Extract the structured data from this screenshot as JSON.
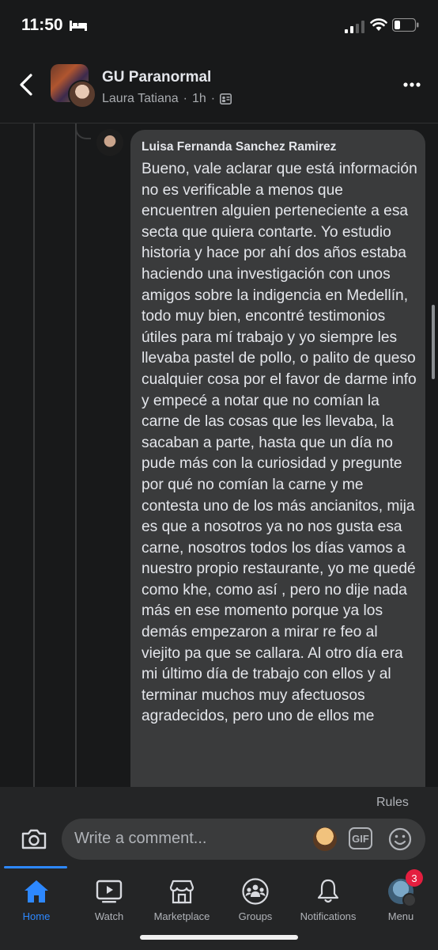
{
  "status_bar": {
    "time": "11:50"
  },
  "header": {
    "group_name": "GU Paranormal",
    "poster_name": "Laura Tatiana",
    "time_ago": "1h",
    "separator": "·"
  },
  "comment": {
    "author": "Luisa Fernanda Sanchez Ramirez",
    "text": "Bueno, vale aclarar que está información no es verificable a menos que encuentren alguien perteneciente a esa secta que quiera contarte. Yo estudio historia y hace por ahí dos años estaba haciendo una investigación con unos amigos sobre la indigencia en Medellín, todo muy bien, encontré testimonios útiles para mí trabajo y yo siempre les llevaba pastel de pollo, o palito de queso cualquier cosa por el favor de darme info y empecé a notar que no comían la carne de las cosas que les llevaba, la sacaban a parte, hasta que un día no pude más con la curiosidad y pregunte por qué no comían la carne y me contesta uno de los más ancianitos, mija es que a nosotros ya no nos gusta esa carne, nosotros todos los días vamos a nuestro propio restaurante, yo me quedé como khe, como así , pero no dije nada más en ese momento porque ya los demás empezaron a mirar re feo al viejito pa que se callara. Al otro día era mi último día de trabajo con ellos y al terminar muchos muy afectuosos agradecidos, pero uno de ellos me"
  },
  "composer": {
    "rules_label": "Rules",
    "placeholder": "Write a comment...",
    "gif_label": "GIF"
  },
  "tabs": [
    {
      "label": "Home",
      "icon": "home-icon",
      "active": true
    },
    {
      "label": "Watch",
      "icon": "watch-icon"
    },
    {
      "label": "Marketplace",
      "icon": "marketplace-icon"
    },
    {
      "label": "Groups",
      "icon": "groups-icon"
    },
    {
      "label": "Notifications",
      "icon": "bell-icon"
    },
    {
      "label": "Menu",
      "icon": "menu-avatar",
      "badge": "3"
    }
  ],
  "colors": {
    "background": "#18191a",
    "bubble": "#3a3b3c",
    "accent": "#2d88ff",
    "badge": "#e41e3f"
  }
}
